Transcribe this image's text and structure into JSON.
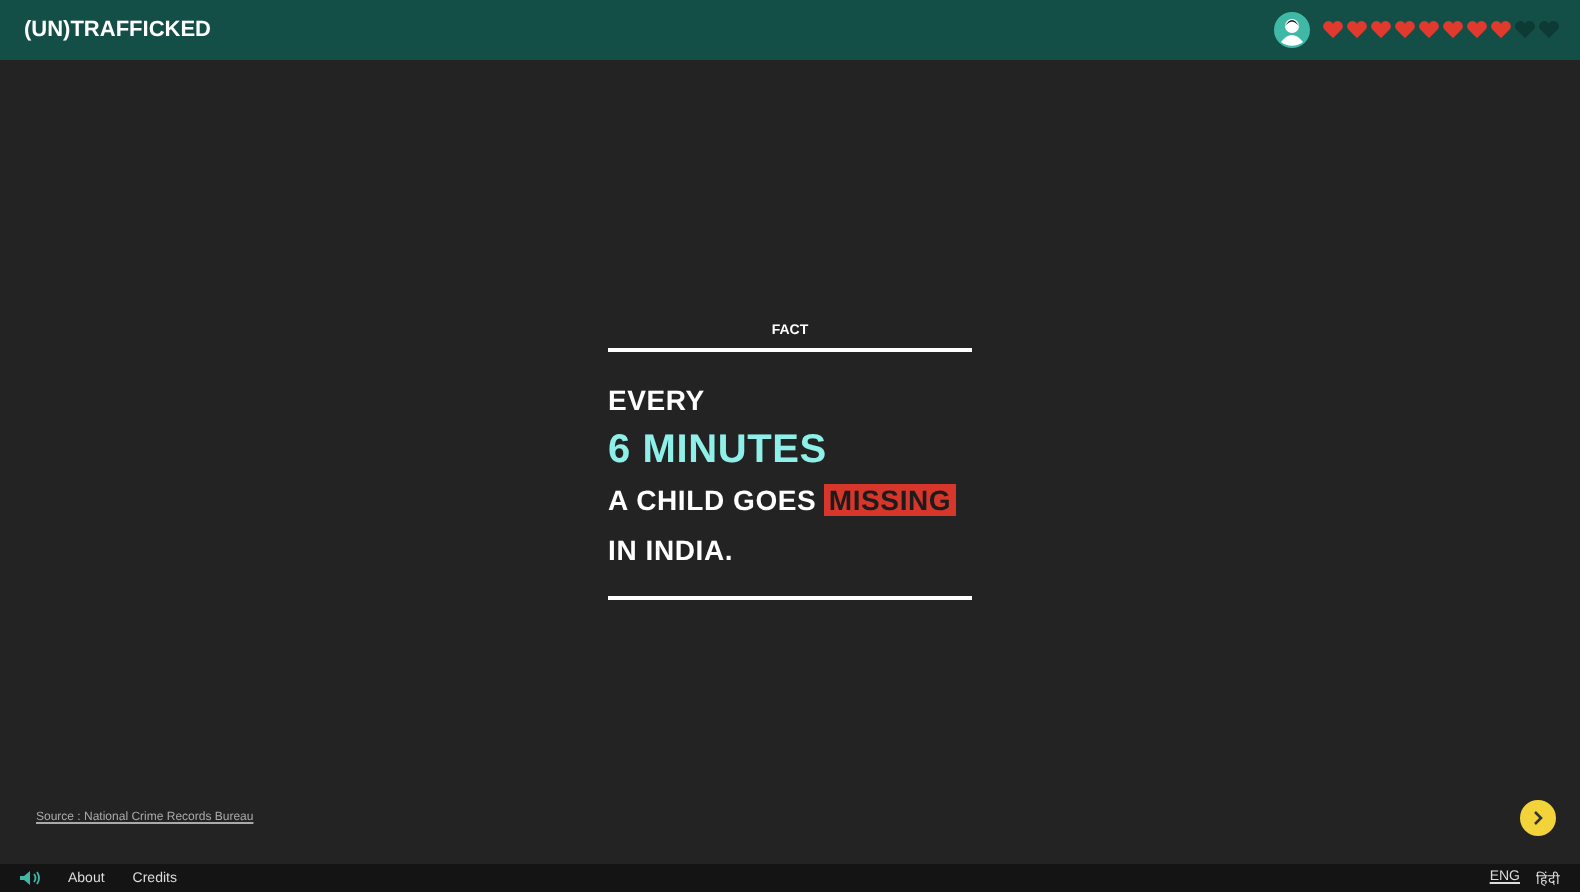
{
  "header": {
    "logo": "(UN)TRAFFICKED",
    "hearts": [
      {
        "filled": true
      },
      {
        "filled": true
      },
      {
        "filled": true
      },
      {
        "filled": true
      },
      {
        "filled": true
      },
      {
        "filled": true
      },
      {
        "filled": true
      },
      {
        "filled": true
      },
      {
        "filled": false
      },
      {
        "filled": false
      }
    ]
  },
  "fact": {
    "label": "FACT",
    "lines": [
      {
        "segments": [
          {
            "text": "EVERY",
            "kind": "plain"
          }
        ]
      },
      {
        "segments": [
          {
            "text": "6 MINUTES",
            "kind": "accent"
          }
        ]
      },
      {
        "segments": [
          {
            "text": "A CHILD GOES ",
            "kind": "plain"
          },
          {
            "text": "MISSING",
            "kind": "highlight"
          }
        ]
      },
      {
        "segments": [
          {
            "text": "IN INDIA.",
            "kind": "plain"
          }
        ]
      }
    ]
  },
  "source": "Source : National Crime Records Bureau",
  "footer": {
    "links": [
      "About",
      "Credits"
    ],
    "languages": [
      {
        "label": "ENG",
        "selected": true
      },
      {
        "label": "हिंदी",
        "selected": false
      }
    ]
  }
}
